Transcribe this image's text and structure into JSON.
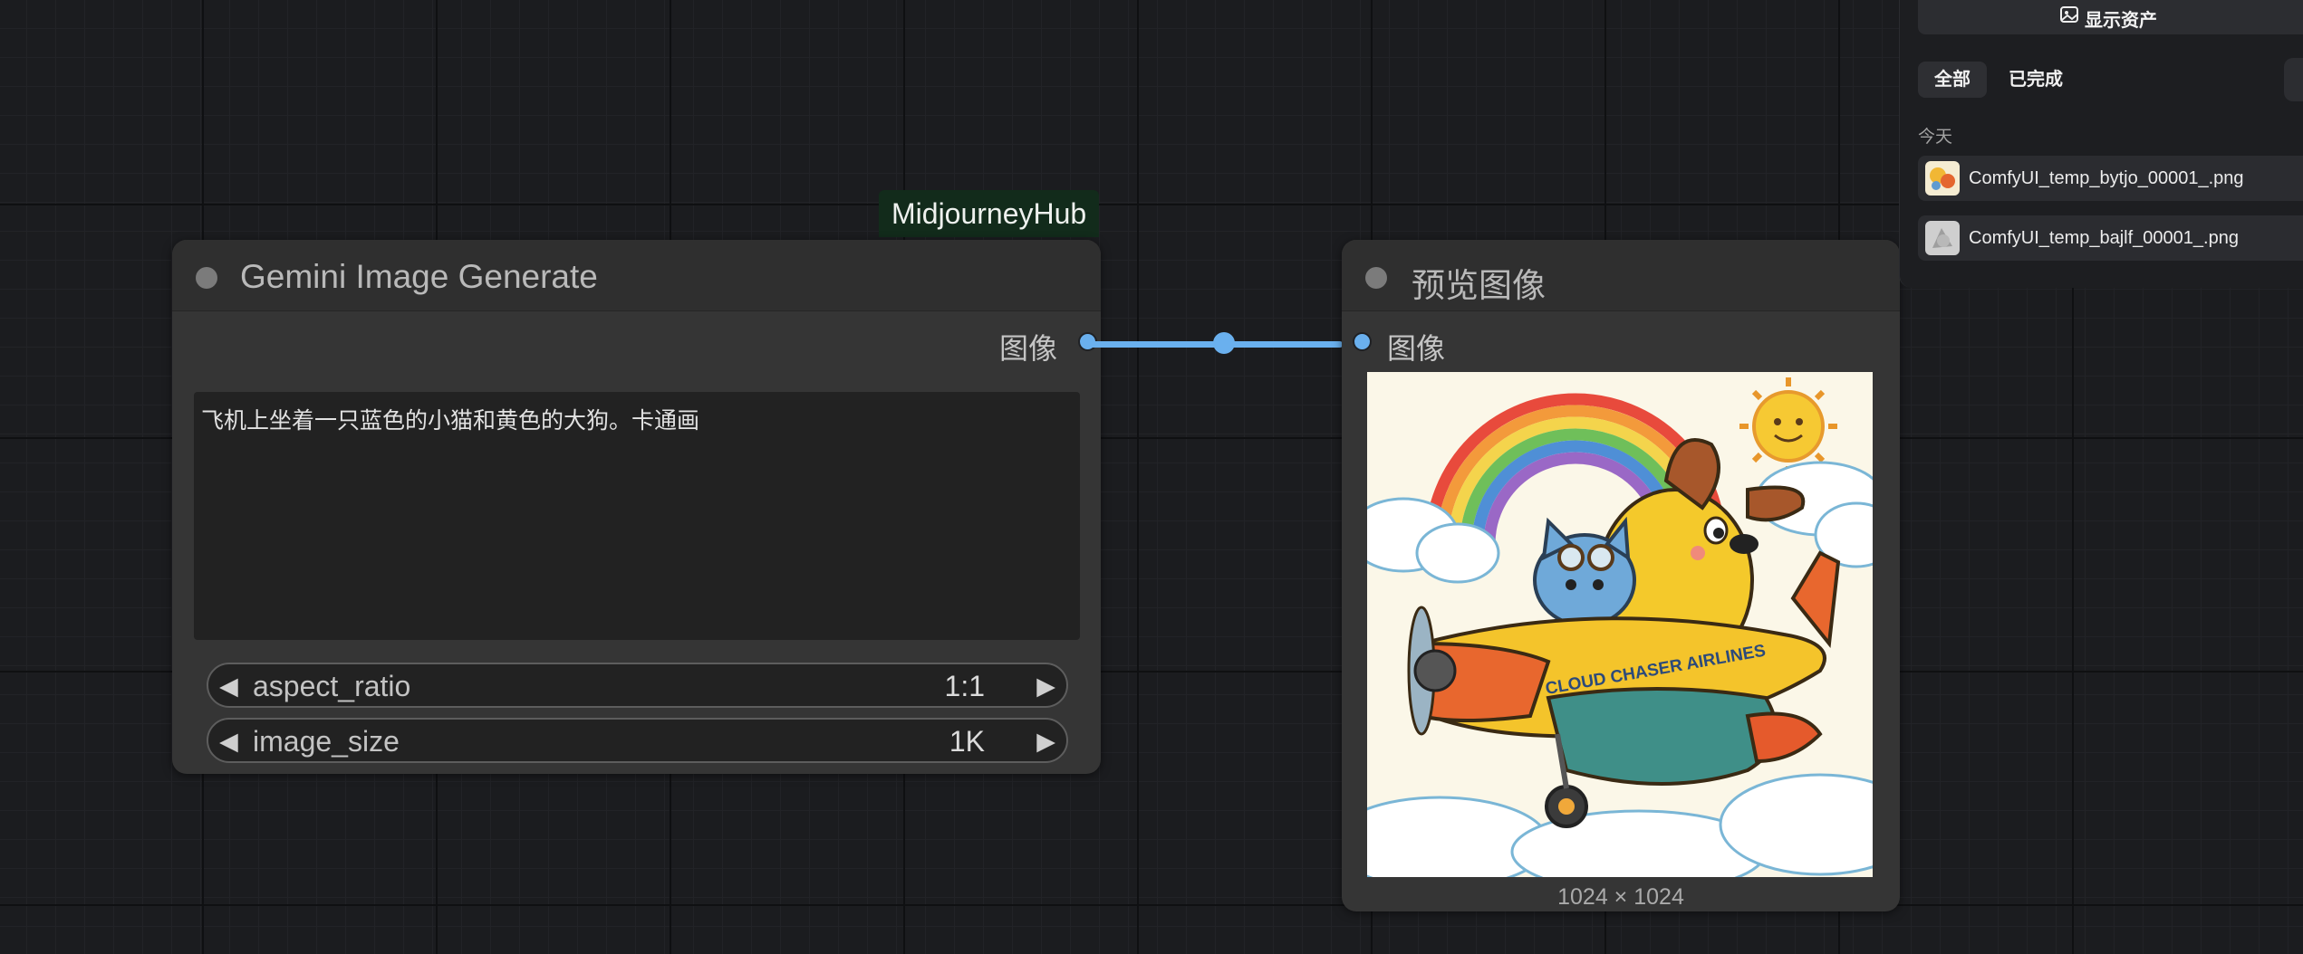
{
  "group_badge": "MidjourneyHub",
  "gemini_node": {
    "title": "Gemini Image Generate",
    "output_label": "图像",
    "prompt": "飞机上坐着一只蓝色的小猫和黄色的大狗。卡通画",
    "widgets": [
      {
        "name": "aspect_ratio",
        "value": "1:1"
      },
      {
        "name": "image_size",
        "value": "1K"
      }
    ]
  },
  "preview_node": {
    "title": "预览图像",
    "input_label": "图像",
    "image_text": "CLOUD CHASER AIRLINES",
    "dimensions": "1024 × 1024"
  },
  "assets_panel": {
    "show_assets_label": "显示资产",
    "tabs": [
      {
        "label": "全部",
        "active": true
      },
      {
        "label": "已完成",
        "active": false
      }
    ],
    "section": "今天",
    "items": [
      {
        "name": "ComfyUI_temp_bytjo_00001_.png"
      },
      {
        "name": "ComfyUI_temp_bajlf_00001_.png"
      }
    ]
  },
  "colors": {
    "link": "#6ab0ee",
    "node_bg": "#353535",
    "badge_bg": "#122b1b"
  }
}
